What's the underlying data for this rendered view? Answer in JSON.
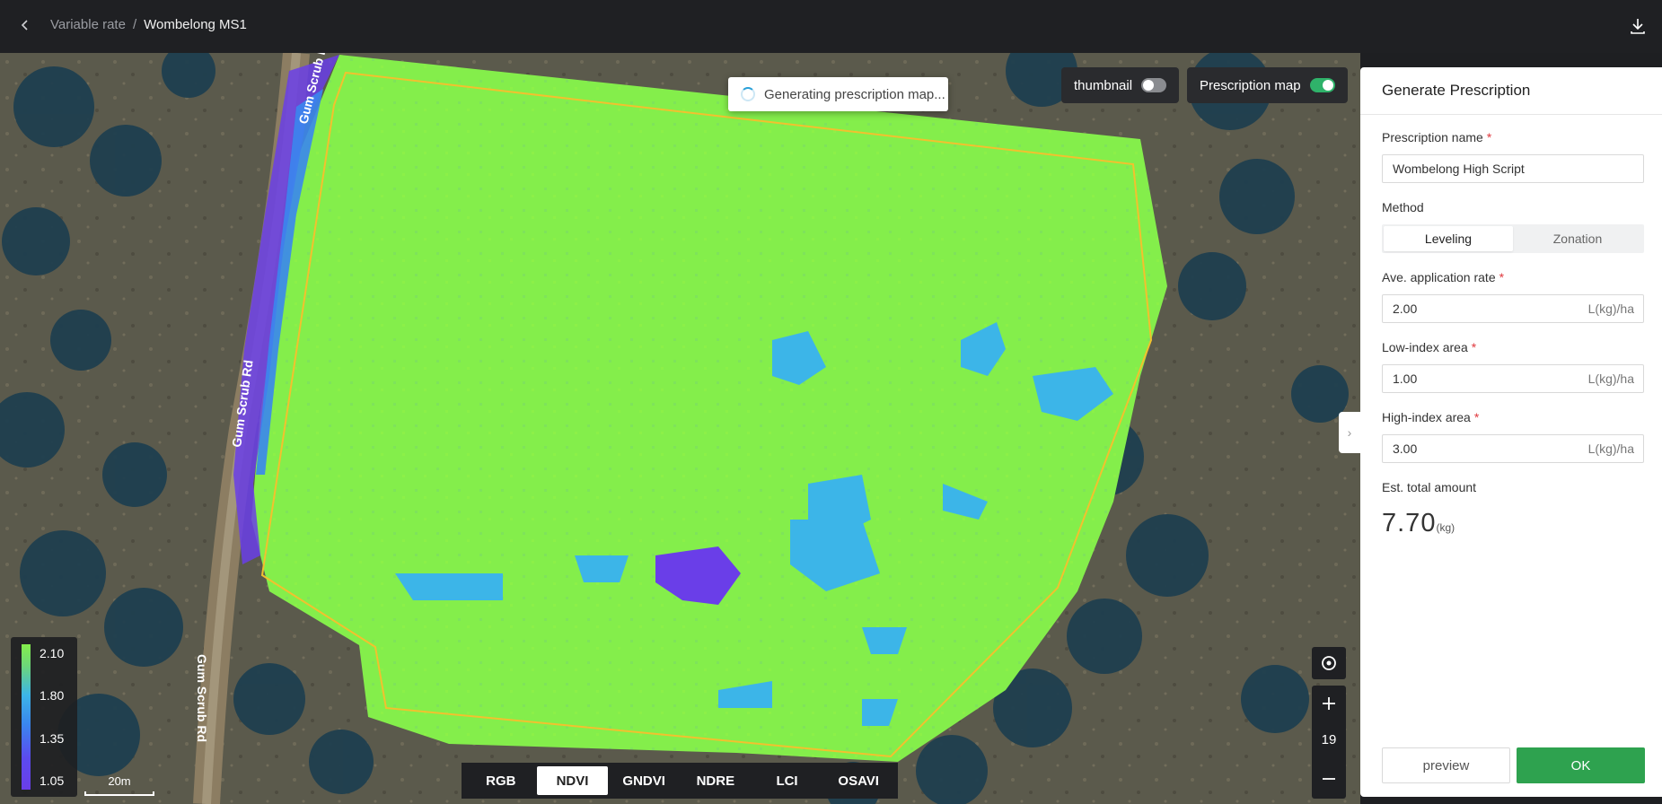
{
  "header": {
    "breadcrumb_parent": "Variable rate",
    "breadcrumb_sep": "/",
    "breadcrumb_current": "Wombelong MS1"
  },
  "toast": {
    "text": "Generating prescription map..."
  },
  "map": {
    "road_labels": [
      "Gum Scrub Rd",
      "Gum Scrub Rd",
      "Gum Scrub Rd"
    ],
    "thumbnail_label": "thumbnail",
    "thumbnail_on": false,
    "prescription_label": "Prescription map",
    "prescription_on": true,
    "legend": [
      "2.10",
      "1.80",
      "1.35",
      "1.05"
    ],
    "scale_label": "20m",
    "zoom_level": "19",
    "index_tabs": [
      "RGB",
      "NDVI",
      "GNDVI",
      "NDRE",
      "LCI",
      "OSAVI"
    ],
    "active_index": "NDVI"
  },
  "panel": {
    "title": "Generate Prescription",
    "name_label": "Prescription name",
    "name_value": "Wombelong High Script",
    "method_label": "Method",
    "methods": [
      "Leveling",
      "Zonation"
    ],
    "active_method": "Leveling",
    "ave_label": "Ave. application rate",
    "ave_value": "2.00",
    "low_label": "Low-index area",
    "low_value": "1.00",
    "high_label": "High-index area",
    "high_value": "3.00",
    "unit": "L(kg)/ha",
    "req_mark": "*",
    "est_label": "Est. total amount",
    "est_value": "7.70",
    "est_unit": "(kg)",
    "preview_label": "preview",
    "ok_label": "OK"
  },
  "colors": {
    "high": "#84ee4b",
    "mid": "#3cb5e8",
    "low": "#6a3ee8",
    "boundary": "#f2c12e",
    "ok": "#2ea24f"
  }
}
